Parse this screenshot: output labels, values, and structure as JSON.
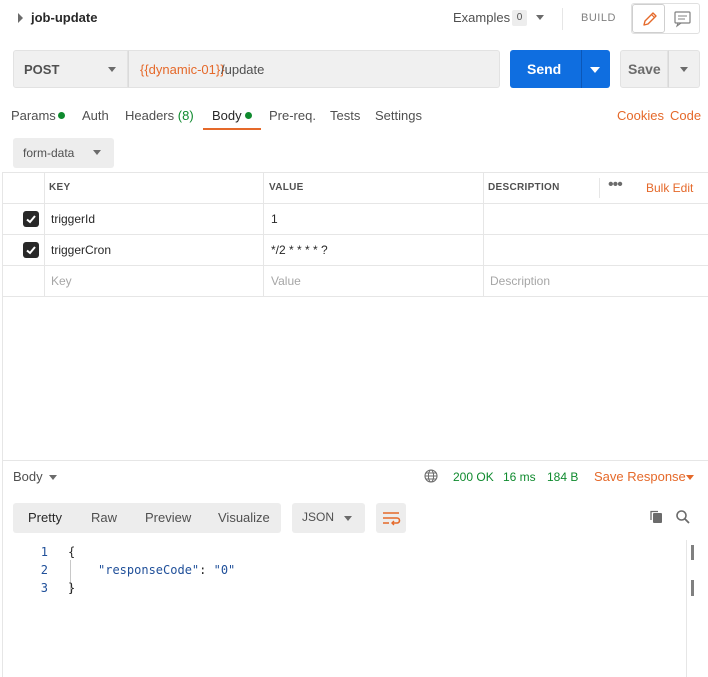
{
  "request": {
    "title": "job-update",
    "examples_label": "Examples",
    "examples_count": "0",
    "build_label": "BUILD",
    "method": "POST",
    "url_variable": "{{dynamic-01}}",
    "url_path": "/update",
    "send_label": "Send",
    "save_label": "Save"
  },
  "tabs": [
    {
      "label": "Params"
    },
    {
      "label": "Auth"
    },
    {
      "label": "Headers",
      "count": "(8)"
    },
    {
      "label": "Body"
    },
    {
      "label": "Pre-req."
    },
    {
      "label": "Tests"
    },
    {
      "label": "Settings"
    }
  ],
  "tab_links": {
    "cookies": "Cookies",
    "code": "Code"
  },
  "body_type": "form-data",
  "table": {
    "headers": {
      "key": "KEY",
      "value": "VALUE",
      "description": "DESCRIPTION"
    },
    "bulk_edit": "Bulk Edit",
    "rows": [
      {
        "key": "triggerId",
        "value": "1",
        "description": "",
        "checked": true
      },
      {
        "key": "triggerCron",
        "value": "*/2 * * * * ?",
        "description": "",
        "checked": true
      }
    ],
    "placeholders": {
      "key": "Key",
      "value": "Value",
      "description": "Description"
    }
  },
  "response": {
    "body_label": "Body",
    "status": "200 OK",
    "time": "16 ms",
    "size": "184 B",
    "save_response": "Save Response",
    "views": [
      "Pretty",
      "Raw",
      "Preview",
      "Visualize"
    ],
    "format": "JSON",
    "line_numbers": [
      "1",
      "2",
      "3"
    ],
    "code": {
      "open": "{",
      "key": "\"responseCode\"",
      "colon": ": ",
      "value": "\"0\"",
      "close": "}"
    }
  },
  "colors": {
    "accent": "#e5692a",
    "primary": "#0f6ee0",
    "success": "#0f8a2e"
  }
}
